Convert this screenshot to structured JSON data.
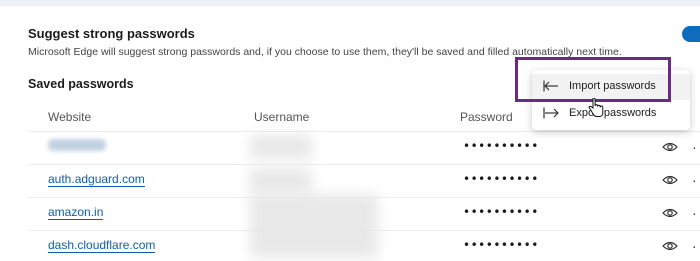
{
  "suggest": {
    "title": "Suggest strong passwords",
    "description": "Microsoft Edge will suggest strong passwords and, if you choose to use them, they'll be saved and filled automatically next time.",
    "toggle_on": true
  },
  "saved": {
    "title": "Saved passwords",
    "columns": {
      "website": "Website",
      "username": "Username",
      "password": "Password"
    },
    "rows": [
      {
        "site": "",
        "masked": "••••••••••"
      },
      {
        "site": "auth.adguard.com",
        "masked": "••••••••••"
      },
      {
        "site": "amazon.in",
        "masked": "••••••••••"
      },
      {
        "site": "dash.cloudflare.com",
        "masked": "••••••••••"
      }
    ],
    "more_glyph": "·"
  },
  "menu": {
    "import_label": "Import passwords",
    "export_label": "Export passwords"
  },
  "colors": {
    "accent": "#0f6cbd",
    "link": "#0f5fab",
    "highlight": "#6b2a86"
  },
  "icons": {
    "import": "import-arrow-icon",
    "export": "export-arrow-icon",
    "reveal": "eye-icon",
    "cursor": "hand-pointer-icon"
  }
}
